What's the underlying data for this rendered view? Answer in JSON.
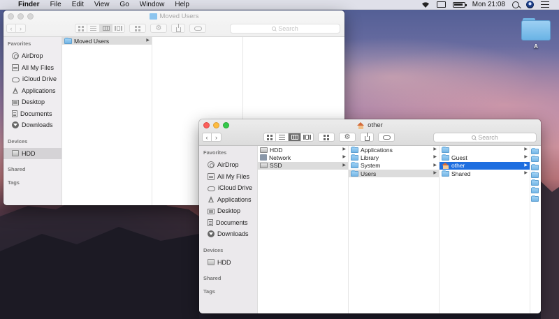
{
  "menubar": {
    "apple": "",
    "items": [
      "Finder",
      "File",
      "Edit",
      "View",
      "Go",
      "Window",
      "Help"
    ],
    "clock": "Mon 21:08"
  },
  "desktop": {
    "icon_label": "A"
  },
  "window_back": {
    "title": "Moved Users",
    "search_placeholder": "Search",
    "sidebar": {
      "favorites_header": "Favorites",
      "favorites": [
        "AirDrop",
        "All My Files",
        "iCloud Drive",
        "Applications",
        "Desktop",
        "Documents",
        "Downloads"
      ],
      "devices_header": "Devices",
      "devices": [
        "HDD"
      ],
      "shared_header": "Shared",
      "tags_header": "Tags"
    },
    "column1": [
      "Moved Users"
    ]
  },
  "window_front": {
    "title": "other",
    "search_placeholder": "Search",
    "sidebar": {
      "favorites_header": "Favorites",
      "favorites": [
        "AirDrop",
        "All My Files",
        "iCloud Drive",
        "Applications",
        "Desktop",
        "Documents",
        "Downloads"
      ],
      "devices_header": "Devices",
      "devices": [
        "HDD"
      ],
      "shared_header": "Shared",
      "tags_header": "Tags"
    },
    "column1": [
      "HDD",
      "Network",
      "SSD"
    ],
    "column2": [
      "Applications",
      "Library",
      "System",
      "Users"
    ],
    "column3": [
      "",
      "Guest",
      "other",
      "Shared"
    ]
  },
  "colors": {
    "selection_blue": "#1d6ee0",
    "folder_blue": "#73b6e6",
    "close_red": "#fc605c",
    "minimize_yellow": "#fdbc40",
    "zoom_green": "#34c84a"
  },
  "icons": {
    "menubar_right": [
      "wifi-icon",
      "airplay-icon",
      "battery-icon",
      "spotlight-icon",
      "user-icon",
      "notification-list-icon"
    ]
  }
}
